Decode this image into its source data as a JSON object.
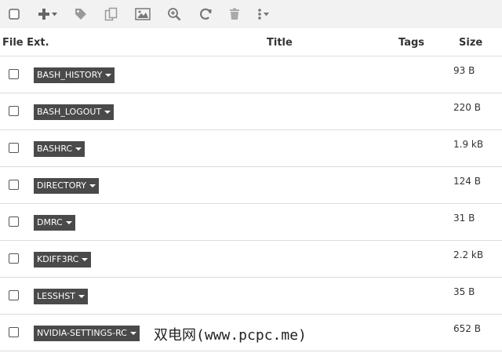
{
  "toolbar": {
    "icons": [
      "checkbox-icon",
      "plus-icon",
      "tag-icon",
      "copy-icon",
      "image-icon",
      "zoom-in-icon",
      "refresh-icon",
      "trash-icon",
      "more-options-icon"
    ]
  },
  "table": {
    "columns": [
      "File Ext.",
      "Title",
      "Tags",
      "Size"
    ],
    "rows": [
      {
        "ext": "BASH_HISTORY",
        "size": "93 B"
      },
      {
        "ext": "BASH_LOGOUT",
        "size": "220 B"
      },
      {
        "ext": "BASHRC",
        "size": "1.9 kB"
      },
      {
        "ext": "DIRECTORY",
        "size": "124 B"
      },
      {
        "ext": "DMRC",
        "size": "31 B"
      },
      {
        "ext": "KDIFF3RC",
        "size": "2.2 kB"
      },
      {
        "ext": "LESSHST",
        "size": "35 B"
      },
      {
        "ext": "NVIDIA-SETTINGS-RC",
        "size": "652 B"
      }
    ]
  },
  "watermark": "双电网(www.pcpc.me)",
  "colors": {
    "toolbar_bg": "#f2f2f2",
    "icon_gray": "#8a8a8a",
    "tag_bg": "#4a4a4a",
    "divider": "#dcdcdc"
  }
}
